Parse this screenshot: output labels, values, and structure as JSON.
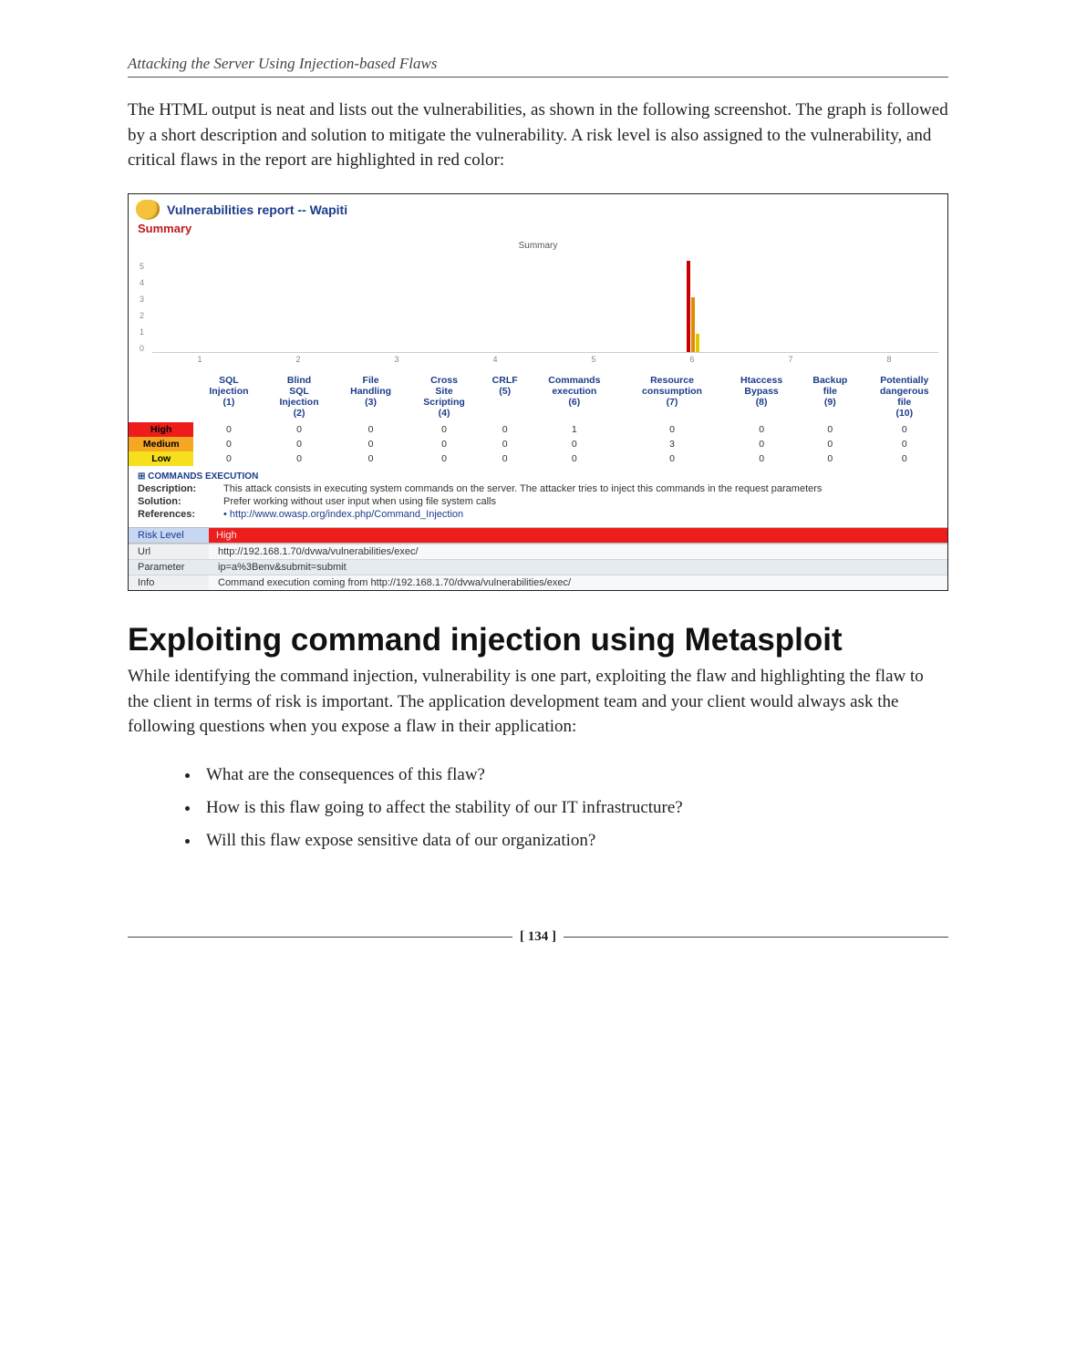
{
  "running_head": "Attacking the Server Using Injection-based Flaws",
  "intro_para": "The HTML output is neat and lists out the vulnerabilities, as shown in the following screenshot. The graph is followed by a short description and solution to mitigate the vulnerability. A risk level is also assigned to the vulnerability, and critical flaws in the report are highlighted in red color:",
  "shot": {
    "title": "Vulnerabilities report -- Wapiti",
    "summary_link": "Summary",
    "chart_subtitle": "Summary"
  },
  "chart_data": {
    "type": "bar",
    "title": "Summary",
    "xlabel": "",
    "ylabel": "",
    "ylim": [
      0,
      5
    ],
    "yticks": [
      5,
      4,
      3,
      2,
      1,
      0
    ],
    "categories": [
      "1",
      "2",
      "3",
      "4",
      "5",
      "6",
      "7",
      "8"
    ],
    "series": [
      {
        "name": "High",
        "values": [
          0,
          0,
          0,
          0,
          0,
          5,
          0,
          0
        ]
      },
      {
        "name": "Medium",
        "values": [
          0,
          0,
          0,
          0,
          0,
          3,
          0,
          0
        ]
      },
      {
        "name": "Low",
        "values": [
          0,
          0,
          0,
          0,
          0,
          1,
          0,
          0
        ]
      }
    ]
  },
  "vuln_table": {
    "row_headers": [
      "High",
      "Medium",
      "Low"
    ],
    "col_headers": [
      "SQL Injection (1)",
      "Blind SQL Injection (2)",
      "File Handling (3)",
      "Cross Site Scripting (4)",
      "CRLF (5)",
      "Commands execution (6)",
      "Resource consumption (7)",
      "Htaccess Bypass (8)",
      "Backup file (9)",
      "Potentially dangerous file (10)"
    ],
    "rows": [
      [
        0,
        0,
        0,
        0,
        0,
        1,
        0,
        0,
        0,
        0
      ],
      [
        0,
        0,
        0,
        0,
        0,
        0,
        3,
        0,
        0,
        0
      ],
      [
        0,
        0,
        0,
        0,
        0,
        0,
        0,
        0,
        0,
        0
      ]
    ]
  },
  "details": {
    "section": "COMMANDS EXECUTION",
    "labels": {
      "description": "Description:",
      "solution": "Solution:",
      "references": "References:"
    },
    "description": "This attack consists in executing system commands on the server. The attacker tries to inject this commands in the request parameters",
    "solution": "Prefer working without user input when using file system calls",
    "reference_link": "http://www.owasp.org/index.php/Command_Injection",
    "risk_label": "Risk Level",
    "risk_value": "High",
    "rows": [
      {
        "k": "Url",
        "v": "http://192.168.1.70/dvwa/vulnerabilities/exec/"
      },
      {
        "k": "Parameter",
        "v": "ip=a%3Benv&submit=submit"
      },
      {
        "k": "Info",
        "v": "Command execution coming from http://192.168.1.70/dvwa/vulnerabilities/exec/"
      }
    ]
  },
  "section_heading": "Exploiting command injection using Metasploit",
  "section_para": "While identifying the command injection, vulnerability is one part, exploiting the flaw and highlighting the flaw to the client in terms of risk is important. The application development team and your client would always ask the following questions when you expose a flaw in their application:",
  "questions": [
    "What are the consequences of this flaw?",
    "How is this flaw going to affect the stability of our IT infrastructure?",
    "Will this flaw expose sensitive data of our organization?"
  ],
  "page_number": "[ 134 ]"
}
